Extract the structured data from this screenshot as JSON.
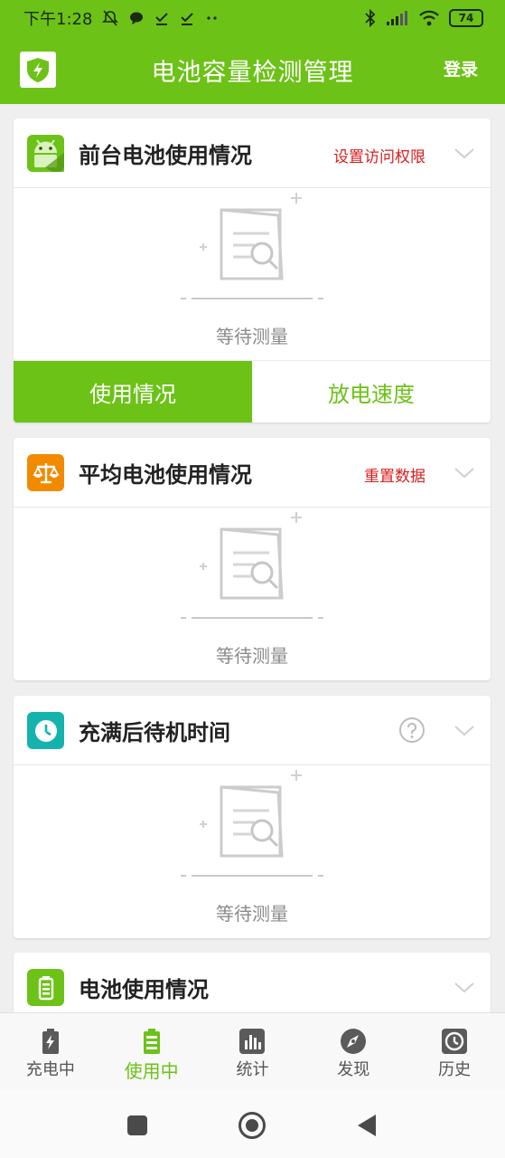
{
  "status_bar": {
    "time": "下午1:28",
    "battery": "74"
  },
  "app_bar": {
    "title": "电池容量检测管理",
    "login_label": "登录"
  },
  "cards": [
    {
      "title": "前台电池使用情况",
      "action": "设置访问权限",
      "empty_text": "等待测量",
      "tabs": [
        "使用情况",
        "放电速度"
      ]
    },
    {
      "title": "平均电池使用情况",
      "action": "重置数据",
      "empty_text": "等待测量"
    },
    {
      "title": "充满后待机时间",
      "empty_text": "等待测量"
    },
    {
      "title": "电池使用情况"
    }
  ],
  "bottom_nav": [
    {
      "label": "充电中",
      "icon": "battery-charging-icon"
    },
    {
      "label": "使用中",
      "icon": "battery-icon"
    },
    {
      "label": "统计",
      "icon": "bar-chart-icon"
    },
    {
      "label": "发现",
      "icon": "compass-icon"
    },
    {
      "label": "历史",
      "icon": "clock-icon"
    }
  ],
  "colors": {
    "accent": "#6cc217",
    "warning": "#d61e1e",
    "orange": "#f28a00",
    "teal": "#14b3ad"
  }
}
